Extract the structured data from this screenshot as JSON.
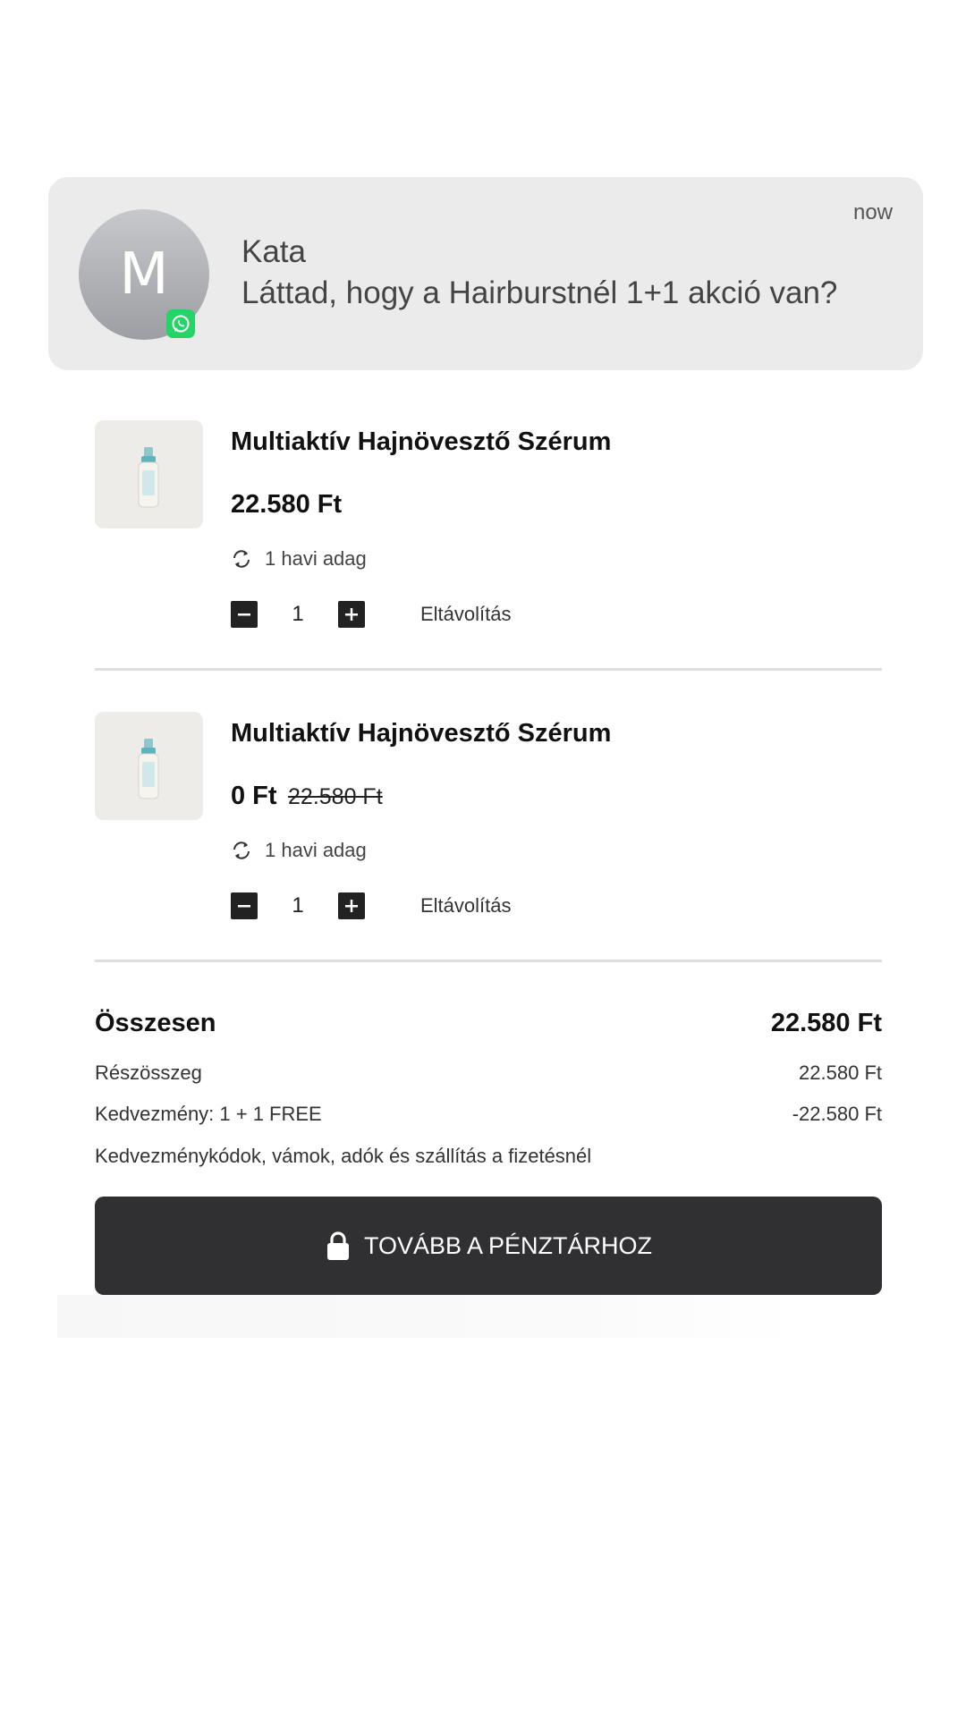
{
  "notification": {
    "avatar_initial": "M",
    "app_badge_icon": "whatsapp-icon",
    "time": "now",
    "sender": "Kata",
    "message": "Láttad, hogy a Hairburstnél 1+1 akció van?"
  },
  "cart": {
    "items": [
      {
        "title": "Multiaktív Hajnövesztő Szérum",
        "price": "22.580 Ft",
        "old_price": "",
        "subscription": "1 havi adag",
        "quantity": "1",
        "remove_label": "Eltávolítás"
      },
      {
        "title": "Multiaktív Hajnövesztő Szérum",
        "price": "0 Ft",
        "old_price": "22.580 Ft",
        "subscription": "1 havi adag",
        "quantity": "1",
        "remove_label": "Eltávolítás"
      }
    ]
  },
  "summary": {
    "total_label": "Összesen",
    "total_value": "22.580 Ft",
    "subtotal_label": "Részösszeg",
    "subtotal_value": "22.580 Ft",
    "discount_label": "Kedvezmény: 1 + 1 FREE",
    "discount_value": "-22.580 Ft",
    "note": "Kedvezménykódok, vámok, adók és szállítás a fizetésnél"
  },
  "checkout": {
    "label": "TOVÁBB A PÉNZTÁRHOZ",
    "icon": "lock-icon"
  },
  "colors": {
    "notification_bg": "#ebebeb",
    "button_bg": "#303032",
    "whatsapp_green": "#25d366"
  }
}
